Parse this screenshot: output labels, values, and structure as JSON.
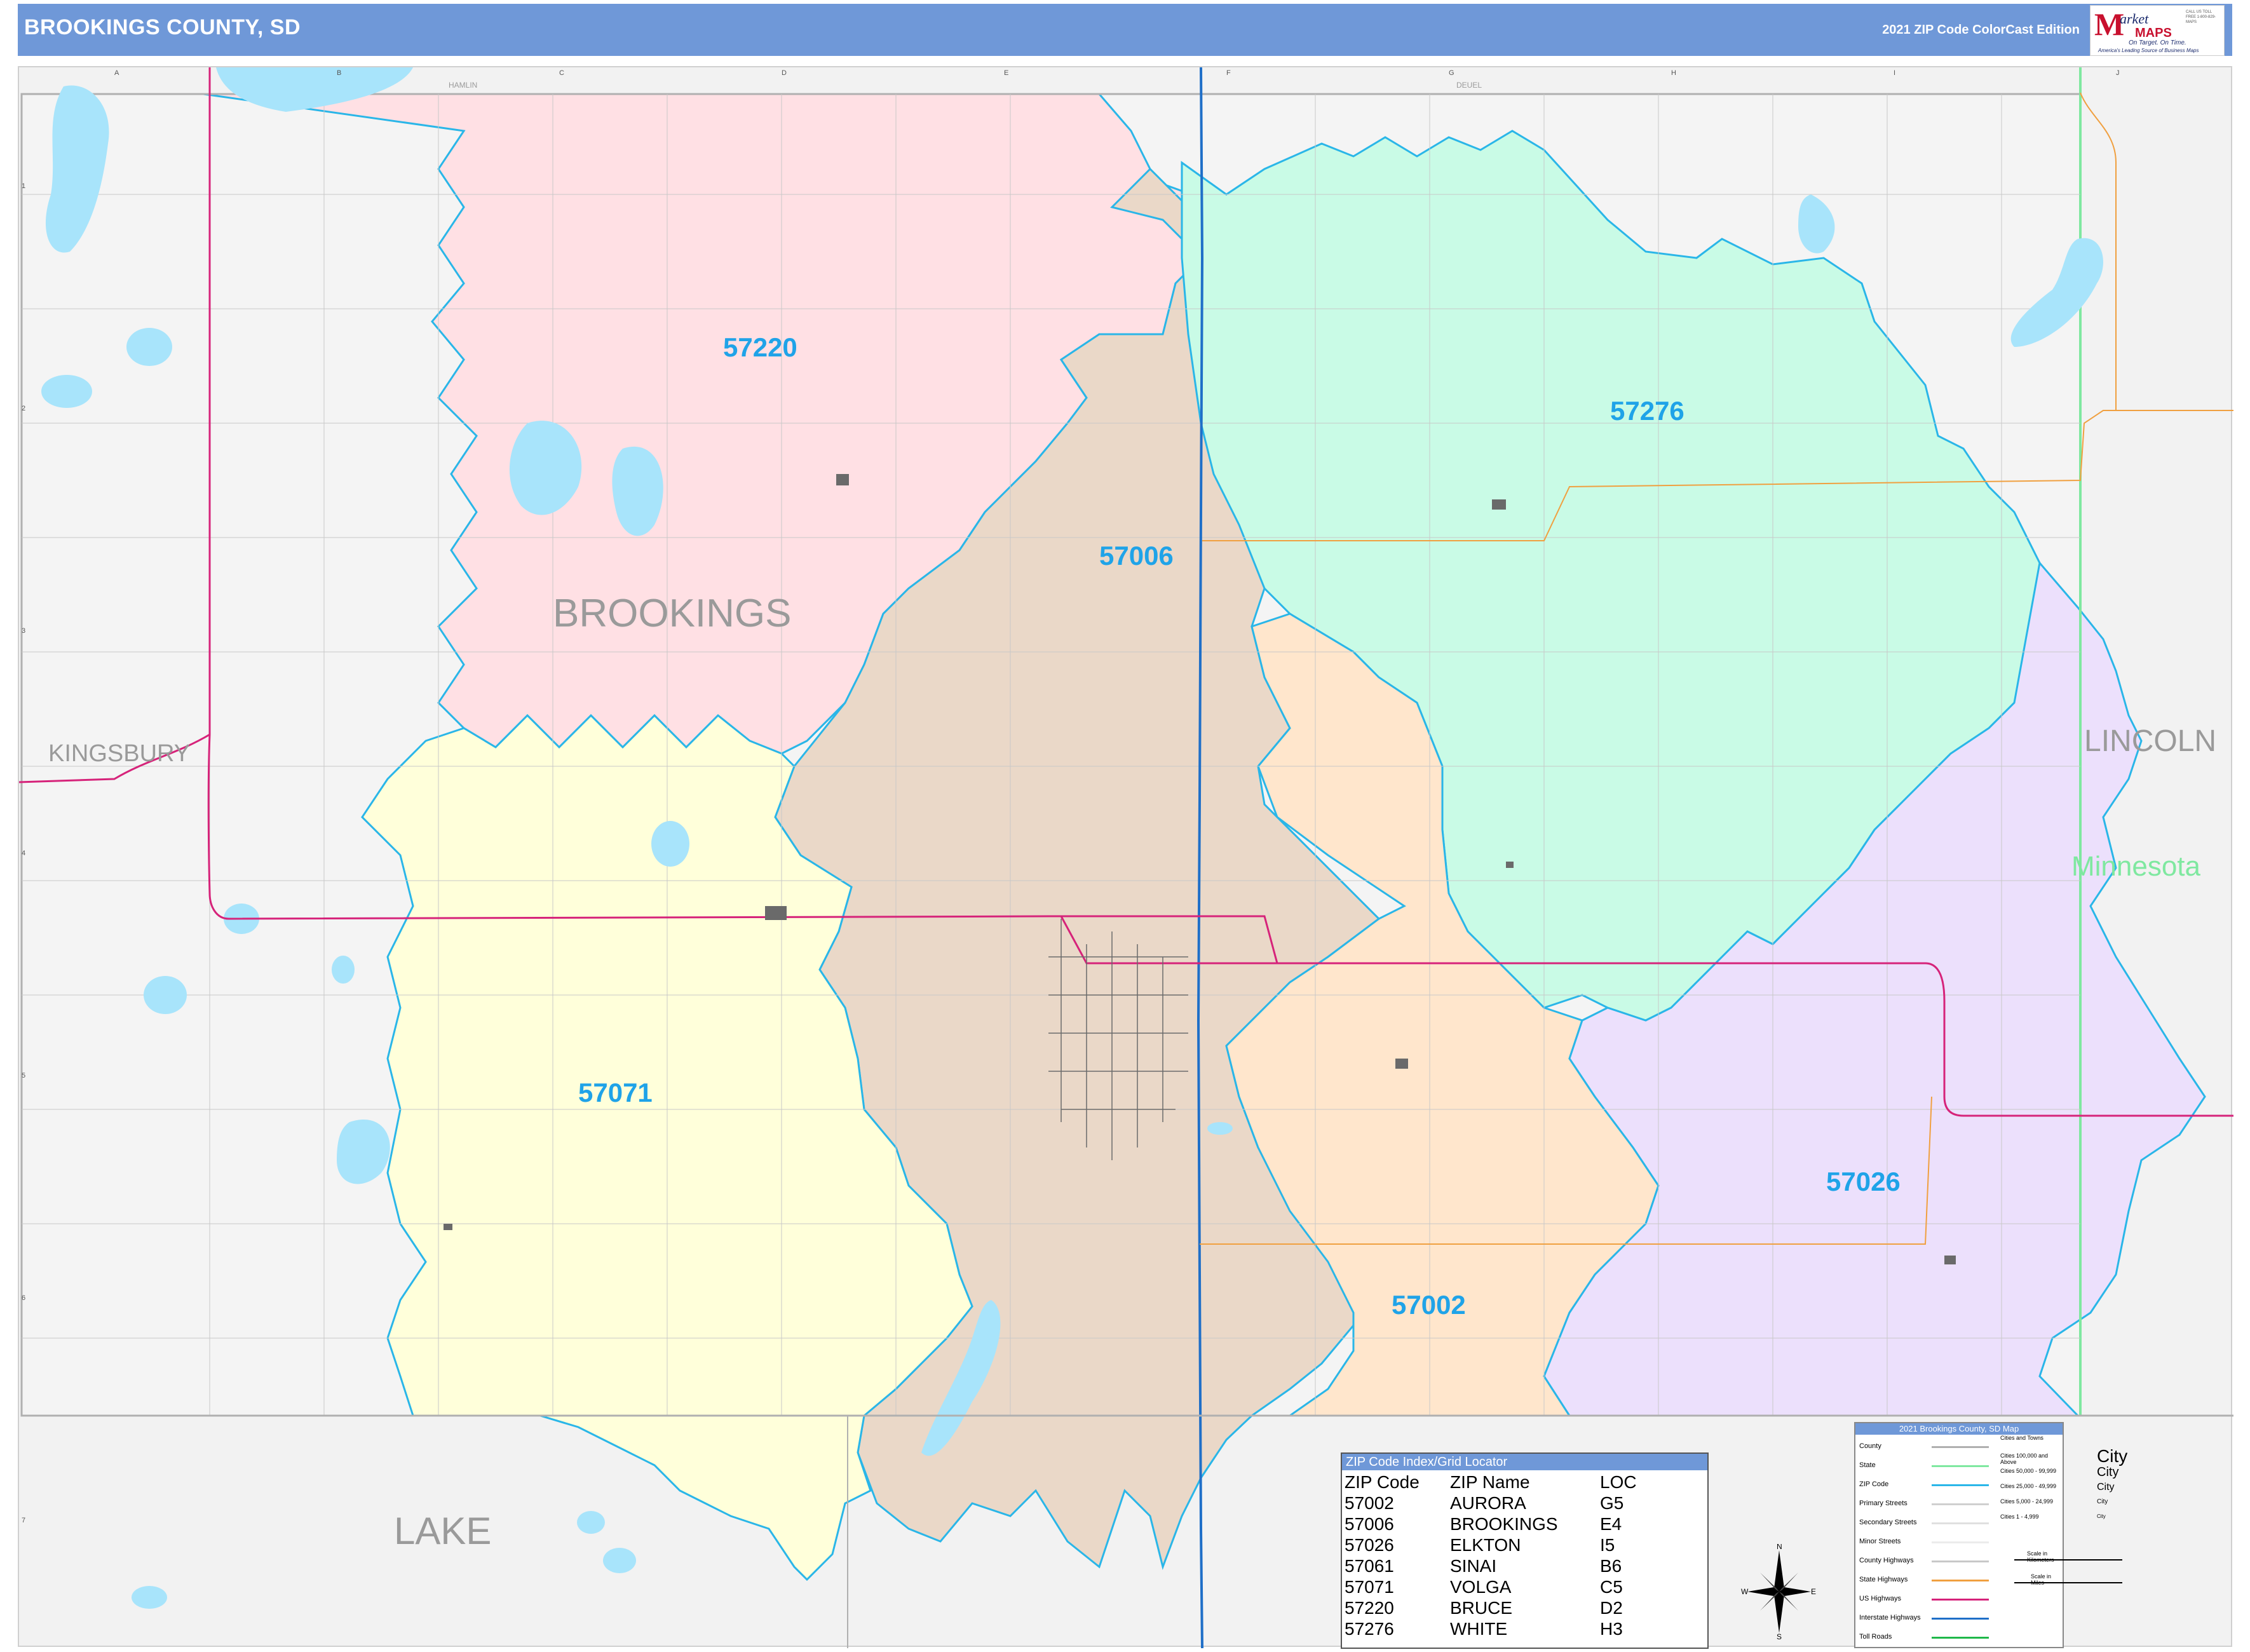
{
  "header": {
    "title": "BROOKINGS COUNTY, SD",
    "edition": "2021 ZIP Code ColorCast Edition",
    "logo": {
      "m": "M",
      "arket": "arket",
      "maps": "MAPS",
      "tagline": "On Target. On Time.",
      "subtagline": "America's Leading Source of Business Maps",
      "contact": "CALL US TOLL FREE 1-800-829-MAPS"
    }
  },
  "map": {
    "zips": [
      {
        "code": "57220",
        "color": "#ffe0e4"
      },
      {
        "code": "57006",
        "color": "#ead8c8"
      },
      {
        "code": "57276",
        "color": "#c9fbe6"
      },
      {
        "code": "57071",
        "color": "#ffffda"
      },
      {
        "code": "57002",
        "color": "#ffe6cc"
      },
      {
        "code": "57026",
        "color": "#ece0fc"
      }
    ],
    "counties": {
      "brookings": "BROOKINGS",
      "kingsbury": "KINGSBURY",
      "lincoln": "LINCOLN",
      "lake": "LAKE"
    },
    "state": "Minnesota",
    "grid_cols": [
      "A",
      "B",
      "C",
      "D",
      "E",
      "F",
      "G",
      "H",
      "I",
      "J"
    ],
    "grid_rows": [
      "1",
      "2",
      "3",
      "4",
      "5",
      "6",
      "7"
    ],
    "top_counties": [
      "HAMLIN",
      "DEUEL"
    ],
    "colors": {
      "zip_border": "#2ab6e8",
      "water": "#a8e4fb",
      "us_highway": "#d6237a",
      "interstate": "#1f6fc8",
      "state_highway": "#f0a040",
      "state_border": "#7fe8a0",
      "county_border": "#b0b0b0"
    },
    "compass": {
      "n": "N",
      "s": "S",
      "e": "E",
      "w": "W"
    }
  },
  "zip_index": {
    "title": "ZIP Code Index/Grid Locator",
    "columns": [
      "ZIP Code",
      "ZIP Name",
      "LOC"
    ],
    "rows": [
      [
        "57002",
        "AURORA",
        "G5"
      ],
      [
        "57006",
        "BROOKINGS",
        "E4"
      ],
      [
        "57026",
        "ELKTON",
        "I5"
      ],
      [
        "57061",
        "SINAI",
        "B6"
      ],
      [
        "57071",
        "VOLGA",
        "C5"
      ],
      [
        "57220",
        "BRUCE",
        "D2"
      ],
      [
        "57276",
        "WHITE",
        "H3"
      ]
    ]
  },
  "legend": {
    "title": "2021 Brookings County, SD Map",
    "items": [
      "County",
      "State",
      "ZIP Code",
      "Primary Streets",
      "Secondary Streets",
      "Minor Streets",
      "County Highways",
      "State Highways",
      "US Highways",
      "Interstate Highways",
      "Toll Roads"
    ],
    "cities_title": "Cities and Towns",
    "cities": [
      "Cities 100,000 and Above",
      "Cities 50,000 - 99,999",
      "Cities 25,000 - 49,999",
      "Cities 5,000 - 24,999",
      "Cities 1 - 4,999"
    ],
    "city_samples": [
      "City",
      "City",
      "City",
      "City",
      "City"
    ],
    "scale_km": "Scale in Kilometers",
    "scale_mi": "Scale in Miles"
  }
}
